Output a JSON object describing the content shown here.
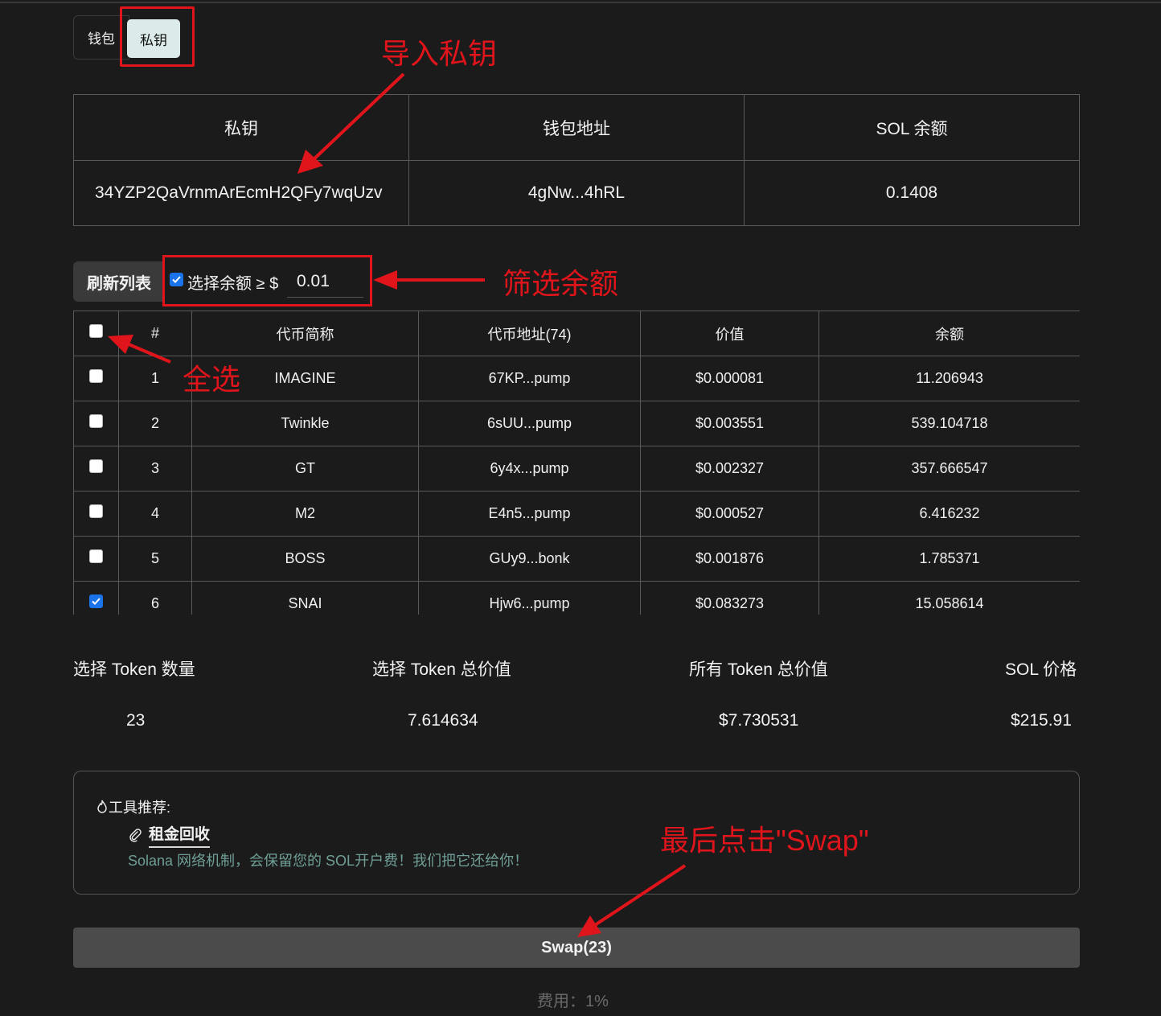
{
  "tabs": {
    "wallet": "钱包",
    "private_key": "私钥"
  },
  "key_table": {
    "headers": [
      "私钥",
      "钱包地址",
      "SOL 余额"
    ],
    "private_key": "34YZP2QaVrnmArEcmH2QFy7wqUzv",
    "wallet_address": "4gNw...4hRL",
    "sol_balance": "0.1408"
  },
  "filter": {
    "refresh_label": "刷新列表",
    "checkbox_label": "选择余额 ≥ $",
    "min_value": "0.01",
    "checked": true
  },
  "token_table": {
    "headers": [
      "#",
      "代币简称",
      "代币地址(74)",
      "价值",
      "余额"
    ],
    "rows": [
      {
        "num": "1",
        "symbol": "IMAGINE",
        "address": "67KP...pump",
        "value": "$0.000081",
        "balance": "11.206943",
        "checked": false
      },
      {
        "num": "2",
        "symbol": "Twinkle",
        "address": "6sUU...pump",
        "value": "$0.003551",
        "balance": "539.104718",
        "checked": false
      },
      {
        "num": "3",
        "symbol": "GT",
        "address": "6y4x...pump",
        "value": "$0.002327",
        "balance": "357.666547",
        "checked": false
      },
      {
        "num": "4",
        "symbol": "M2",
        "address": "E4n5...pump",
        "value": "$0.000527",
        "balance": "6.416232",
        "checked": false
      },
      {
        "num": "5",
        "symbol": "BOSS",
        "address": "GUy9...bonk",
        "value": "$0.001876",
        "balance": "1.785371",
        "checked": false
      },
      {
        "num": "6",
        "symbol": "SNAI",
        "address": "Hjw6...pump",
        "value": "$0.083273",
        "balance": "15.058614",
        "checked": true
      }
    ]
  },
  "summary": {
    "selected_count_label": "选择 Token 数量",
    "selected_count": "23",
    "selected_value_label": "选择 Token 总价值",
    "selected_value": "7.614634",
    "total_value_label": "所有 Token 总价值",
    "total_value": "$7.730531",
    "sol_price_label": "SOL 价格",
    "sol_price": "$215.91"
  },
  "tools": {
    "title": "工具推荐:",
    "link_label": "租金回收",
    "description": "Solana 网络机制，会保留您的 SOL开户费！我们把它还给你！"
  },
  "swap": {
    "label": "Swap(23)",
    "fee": "费用：1%"
  },
  "annotations": {
    "import_key": "导入私钥",
    "filter_balance": "筛选余额",
    "select_all": "全选",
    "click_swap": "最后点击\"Swap\"",
    "color": "#e0141b"
  }
}
